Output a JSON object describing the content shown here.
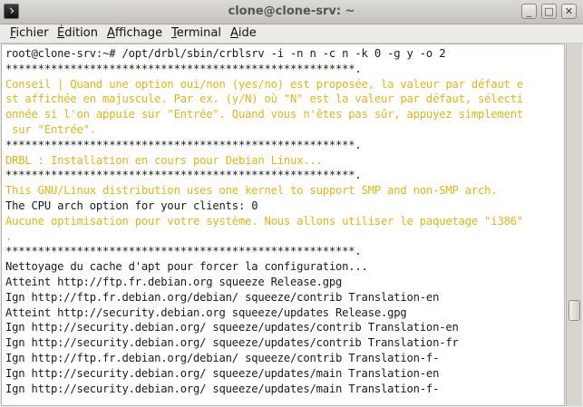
{
  "window": {
    "title": "clone@clone-srv: ~",
    "buttons": {
      "minimize": "_",
      "maximize": "□",
      "close": "✕"
    }
  },
  "menu": [
    {
      "label": "Fichier"
    },
    {
      "label": "Édition"
    },
    {
      "label": "Affichage"
    },
    {
      "label": "Terminal"
    },
    {
      "label": "Aide"
    }
  ],
  "terminal": {
    "lines": [
      {
        "text": "root@clone-srv:~# /opt/drbl/sbin/crblsrv -i -n n -c n -k 0 -g y -o 2",
        "color": "normal"
      },
      {
        "text": "******************************************************.",
        "color": "normal"
      },
      {
        "text": "Conseil | Quand une option oui/non (yes/no) est proposée, la valeur par défaut e",
        "color": "yellow"
      },
      {
        "text": "st affichée en majuscule. Par ex. (y/N) où \"N\" est la valeur par défaut, sélecti",
        "color": "yellow"
      },
      {
        "text": "onnée si l'on appuie sur \"Entrée\". Quand vous n'êtes pas sûr, appuyez simplement",
        "color": "yellow"
      },
      {
        "text": " sur \"Entrée\".",
        "color": "yellow"
      },
      {
        "text": "******************************************************.",
        "color": "normal"
      },
      {
        "text": "DRBL : Installation en cours pour Debian Linux...",
        "color": "yellow"
      },
      {
        "text": "******************************************************.",
        "color": "normal"
      },
      {
        "text": "This GNU/Linux distribution uses one kernel to support SMP and non-SMP arch.",
        "color": "yellow"
      },
      {
        "text": "The CPU arch option for your clients: 0",
        "color": "normal"
      },
      {
        "text": "Aucune optimisation pour votre système. Nous allons utiliser le paquetage \"i386\"",
        "color": "yellow"
      },
      {
        "text": ".",
        "color": "yellow"
      },
      {
        "text": "******************************************************.",
        "color": "normal"
      },
      {
        "text": "Nettoyage du cache d'apt pour forcer la configuration...",
        "color": "normal"
      },
      {
        "text": "Atteint http://ftp.fr.debian.org squeeze Release.gpg",
        "color": "normal"
      },
      {
        "text": "Ign http://ftp.fr.debian.org/debian/ squeeze/contrib Translation-en",
        "color": "normal"
      },
      {
        "text": "Atteint http://security.debian.org squeeze/updates Release.gpg",
        "color": "normal"
      },
      {
        "text": "Ign http://security.debian.org/ squeeze/updates/contrib Translation-en",
        "color": "normal"
      },
      {
        "text": "Ign http://security.debian.org/ squeeze/updates/contrib Translation-fr",
        "color": "normal"
      },
      {
        "text": "Ign http://ftp.fr.debian.org/debian/ squeeze/contrib Translation-f-",
        "color": "normal"
      },
      {
        "text": "Ign http://security.debian.org/ squeeze/updates/main Translation-en",
        "color": "normal"
      },
      {
        "text": "Ign http://security.debian.org/ squeeze/updates/main Translation-f-",
        "color": "normal"
      }
    ]
  },
  "colors": {
    "normal": "#1a1a1a",
    "yellow": "#e3b514",
    "background": "#ffffff"
  }
}
